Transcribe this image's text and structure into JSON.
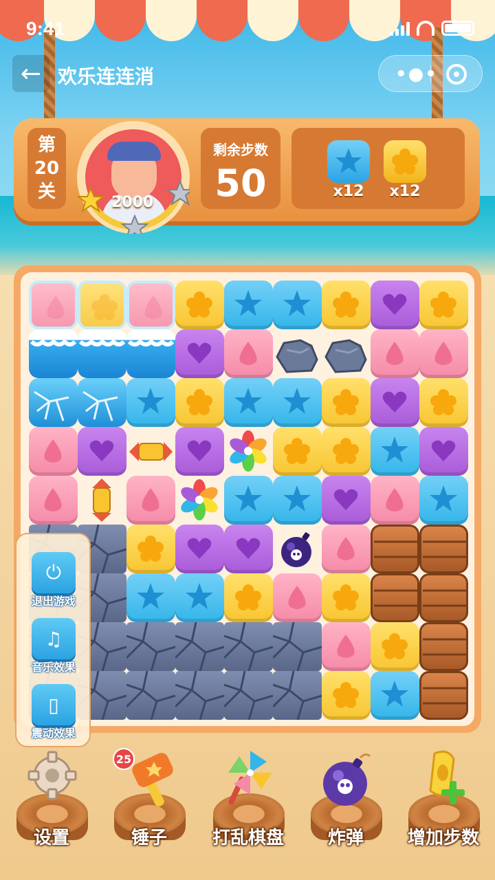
{
  "status_bar": {
    "time": "9:41"
  },
  "nav": {
    "title": "欢乐连连消",
    "more_icon": "more-dots-icon",
    "close_icon": "target-icon"
  },
  "header": {
    "level": [
      "第",
      "20",
      "关"
    ],
    "score": "2000",
    "stars_earned": 1,
    "stars_total": 3,
    "steps_label": "剩余步数",
    "steps_value": "50",
    "goals": [
      {
        "piece": "blue-star",
        "count": "x12"
      },
      {
        "piece": "yellow-flower",
        "count": "x12"
      }
    ]
  },
  "board": {
    "rows": 9,
    "cols": 9,
    "grid": [
      [
        "ice-pink",
        "ice-yellow",
        "ice-pink",
        "yellow",
        "blue",
        "blue",
        "yellow",
        "purple",
        "yellow"
      ],
      [
        "frozen",
        "frozen",
        "frozen",
        "purple",
        "pink",
        "rock",
        "rock",
        "pink",
        "pink"
      ],
      [
        "cracked-ice",
        "cracked-ice",
        "blue",
        "yellow",
        "blue",
        "blue",
        "yellow",
        "purple",
        "yellow"
      ],
      [
        "pink",
        "purple",
        "rocket-h",
        "purple",
        "rainbow",
        "yellow",
        "yellow",
        "blue",
        "purple"
      ],
      [
        "pink",
        "rocket-v",
        "pink",
        "rainbow",
        "blue",
        "blue",
        "purple",
        "pink",
        "blue"
      ],
      [
        "stone-big",
        "stone-big",
        "yellow",
        "purple",
        "purple",
        "bomb",
        "pink",
        "crate",
        "crate"
      ],
      [
        "stone-big",
        "stone-big",
        "blue",
        "blue",
        "yellow",
        "pink",
        "yellow",
        "crate",
        "crate"
      ],
      [
        "stone-big",
        "stone-big",
        "stone-big",
        "stone-big",
        "stone-big",
        "stone-big",
        "pink",
        "yellow",
        "crate"
      ],
      [
        "stone-big",
        "stone-big",
        "stone-big",
        "stone-big",
        "stone-big",
        "stone-big",
        "yellow",
        "blue",
        "crate"
      ]
    ]
  },
  "side_menu": [
    {
      "label": "退出游戏",
      "icon": "power-icon"
    },
    {
      "label": "音乐效果",
      "icon": "music-note-icon"
    },
    {
      "label": "震动效果",
      "icon": "vibrate-icon"
    }
  ],
  "toolbar": [
    {
      "label": "设置",
      "icon": "gear-icon",
      "badge": ""
    },
    {
      "label": "锤子",
      "icon": "hammer-icon",
      "badge": "25"
    },
    {
      "label": "打乱棋盘",
      "icon": "pinwheel-icon",
      "badge": ""
    },
    {
      "label": "炸弹",
      "icon": "bomb-icon",
      "badge": ""
    },
    {
      "label": "增加步数",
      "icon": "add-steps-icon",
      "badge": ""
    }
  ],
  "colors": {
    "yellow": "#f8c531",
    "blue": "#33b5ea",
    "pink": "#f58aa8",
    "purple": "#a85bd9",
    "panel": "#e8913f",
    "board": "#fff1e0"
  }
}
